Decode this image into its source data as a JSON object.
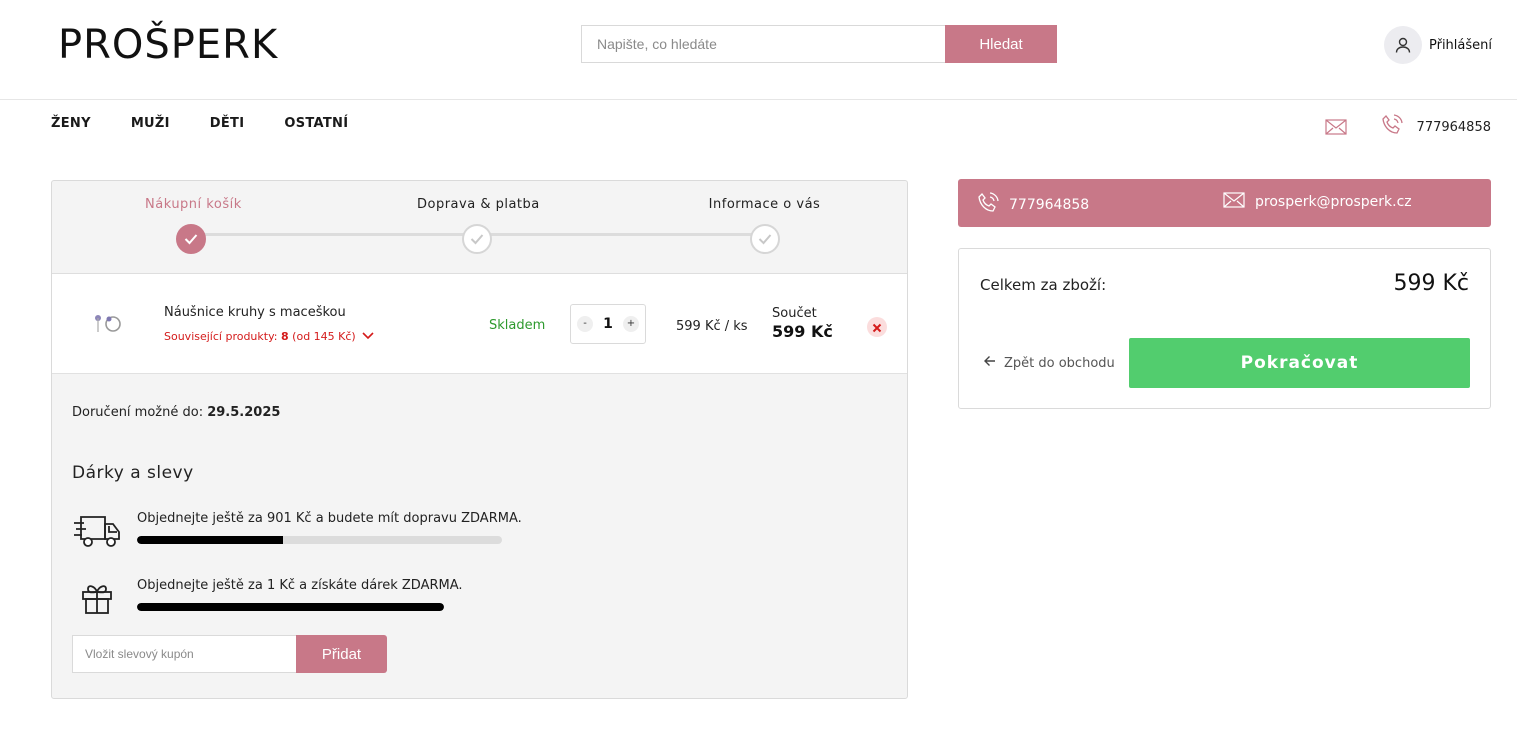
{
  "header": {
    "logo_text": "PROŠPERK",
    "search_placeholder": "Napište, co hledáte",
    "search_button": "Hledat",
    "login_label": "Přihlášení"
  },
  "nav": {
    "items": [
      "ŽENY",
      "MUŽI",
      "DĚTI",
      "OSTATNÍ"
    ],
    "phone": "777964858"
  },
  "steps": [
    {
      "label": "Nákupní košík",
      "active": true
    },
    {
      "label": "Doprava & platba",
      "active": false
    },
    {
      "label": "Informace o vás",
      "active": false
    }
  ],
  "cart_item": {
    "name": "Náušnice kruhy s maceškou",
    "related_prefix": "Související produkty:",
    "related_count": "8",
    "related_from": "(od 145 Kč)",
    "stock": "Skladem",
    "quantity": "1",
    "qty_minus": "-",
    "qty_plus": "+",
    "unit_price": "599 Kč / ks",
    "sum_label": "Součet",
    "sum_value": "599 Kč"
  },
  "delivery": {
    "label": "Doručení možné do:",
    "date": "29.5.2025"
  },
  "gifts": {
    "title": "Dárky a slevy",
    "perks": [
      {
        "icon": "truck-icon",
        "text": "Objednejte ještě za 901 Kč a budete mít dopravu ZDARMA.",
        "progress": 0.4
      },
      {
        "icon": "gift-icon",
        "text": "Objednejte ještě za 1 Kč a získáte dárek ZDARMA.",
        "progress": 1.0
      }
    ],
    "coupon_placeholder": "Vložit slevový kupón",
    "coupon_button": "Přidat"
  },
  "contact_bar": {
    "phone": "777964858",
    "email": "prosperk@prosperk.cz"
  },
  "summary": {
    "total_label": "Celkem za zboží:",
    "total_value": "599 Kč",
    "back_label": "Zpět do obchodu",
    "continue_label": "Pokračovat"
  },
  "colors": {
    "brand": "#c87888",
    "continue": "#52cd6e",
    "stock": "#2e9a2e",
    "related": "#d41b1b"
  }
}
